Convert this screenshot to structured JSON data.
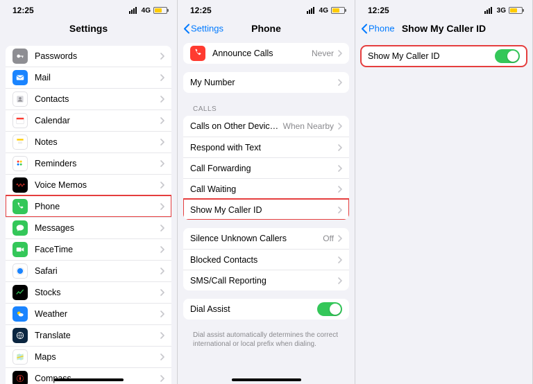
{
  "status": {
    "time": "12:25",
    "net1": "4G",
    "net2": "4G",
    "net3": "3G"
  },
  "screen1": {
    "title": "Settings",
    "items": [
      {
        "label": "Passwords",
        "iconBg": "#8e8e93",
        "glyph": "key"
      },
      {
        "label": "Mail",
        "iconBg": "#1a84ff",
        "glyph": "mail"
      },
      {
        "label": "Contacts",
        "iconBg": "#ffffff",
        "glyph": "contacts"
      },
      {
        "label": "Calendar",
        "iconBg": "#ffffff",
        "glyph": "calendar"
      },
      {
        "label": "Notes",
        "iconBg": "#ffffff",
        "glyph": "notes"
      },
      {
        "label": "Reminders",
        "iconBg": "#ffffff",
        "glyph": "reminders"
      },
      {
        "label": "Voice Memos",
        "iconBg": "#000000",
        "glyph": "voice"
      },
      {
        "label": "Phone",
        "iconBg": "#34c759",
        "glyph": "phone",
        "highlighted": true
      },
      {
        "label": "Messages",
        "iconBg": "#34c759",
        "glyph": "messages"
      },
      {
        "label": "FaceTime",
        "iconBg": "#34c759",
        "glyph": "facetime"
      },
      {
        "label": "Safari",
        "iconBg": "#ffffff",
        "glyph": "safari"
      },
      {
        "label": "Stocks",
        "iconBg": "#000000",
        "glyph": "stocks"
      },
      {
        "label": "Weather",
        "iconBg": "#1a84ff",
        "glyph": "weather"
      },
      {
        "label": "Translate",
        "iconBg": "#0a2540",
        "glyph": "translate"
      },
      {
        "label": "Maps",
        "iconBg": "#ffffff",
        "glyph": "maps"
      },
      {
        "label": "Compass",
        "iconBg": "#000000",
        "glyph": "compass"
      }
    ]
  },
  "screen2": {
    "back": "Settings",
    "title": "Phone",
    "group1": [
      {
        "label": "Announce Calls",
        "value": "Never",
        "iconBg": "#ff3b30",
        "glyph": "phone"
      }
    ],
    "group2": [
      {
        "label": "My Number"
      }
    ],
    "sectionHeader": "CALLS",
    "group3": [
      {
        "label": "Calls on Other Devices",
        "value": "When Nearby"
      },
      {
        "label": "Respond with Text"
      },
      {
        "label": "Call Forwarding"
      },
      {
        "label": "Call Waiting"
      },
      {
        "label": "Show My Caller ID",
        "highlighted": true
      }
    ],
    "group4": [
      {
        "label": "Silence Unknown Callers",
        "value": "Off"
      },
      {
        "label": "Blocked Contacts"
      },
      {
        "label": "SMS/Call Reporting"
      }
    ],
    "group5": [
      {
        "label": "Dial Assist",
        "toggle": true
      }
    ],
    "footer": "Dial assist automatically determines the correct international or local prefix when dialing."
  },
  "screen3": {
    "back": "Phone",
    "title": "Show My Caller ID",
    "row": {
      "label": "Show My Caller ID",
      "toggle": true,
      "highlighted": true
    }
  }
}
